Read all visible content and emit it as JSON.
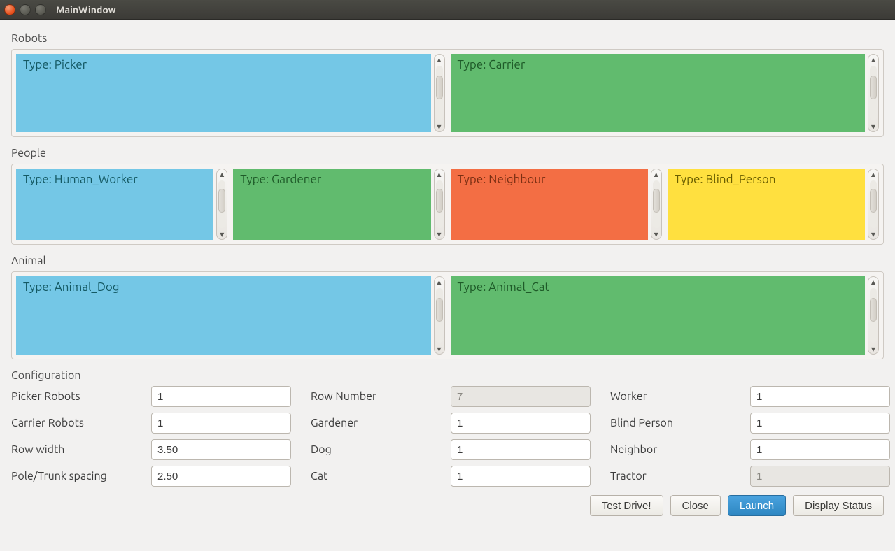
{
  "window": {
    "title": "MainWindow"
  },
  "sections": {
    "robots": {
      "label": "Robots",
      "items": [
        {
          "label": "Type: Picker",
          "color": "blue"
        },
        {
          "label": "Type: Carrier",
          "color": "green"
        }
      ]
    },
    "people": {
      "label": "People",
      "items": [
        {
          "label": "Type: Human_Worker",
          "color": "blue"
        },
        {
          "label": "Type: Gardener",
          "color": "green"
        },
        {
          "label": "Type: Neighbour",
          "color": "orange"
        },
        {
          "label": "Type: Blind_Person",
          "color": "yellow"
        }
      ]
    },
    "animal": {
      "label": "Animal",
      "items": [
        {
          "label": "Type: Animal_Dog",
          "color": "blue"
        },
        {
          "label": "Type: Animal_Cat",
          "color": "green"
        }
      ]
    }
  },
  "config": {
    "label": "Configuration",
    "fields": {
      "picker_robots": {
        "label": "Picker Robots",
        "value": "1"
      },
      "carrier_robots": {
        "label": "Carrier Robots",
        "value": "1"
      },
      "row_width": {
        "label": "Row width",
        "value": "3.50"
      },
      "pole_spacing": {
        "label": "Pole/Trunk spacing",
        "value": "2.50"
      },
      "row_number": {
        "label": "Row Number",
        "value": "7",
        "disabled": true
      },
      "gardener": {
        "label": "Gardener",
        "value": "1"
      },
      "dog": {
        "label": "Dog",
        "value": "1"
      },
      "cat": {
        "label": "Cat",
        "value": "1"
      },
      "worker": {
        "label": "Worker",
        "value": "1"
      },
      "blind_person": {
        "label": "Blind Person",
        "value": "1"
      },
      "neighbor": {
        "label": "Neighbor",
        "value": "1"
      },
      "tractor": {
        "label": "Tractor",
        "value": "1",
        "disabled": true
      }
    }
  },
  "footer": {
    "test_drive": "Test Drive!",
    "close": "Close",
    "launch": "Launch",
    "display_status": "Display Status"
  }
}
